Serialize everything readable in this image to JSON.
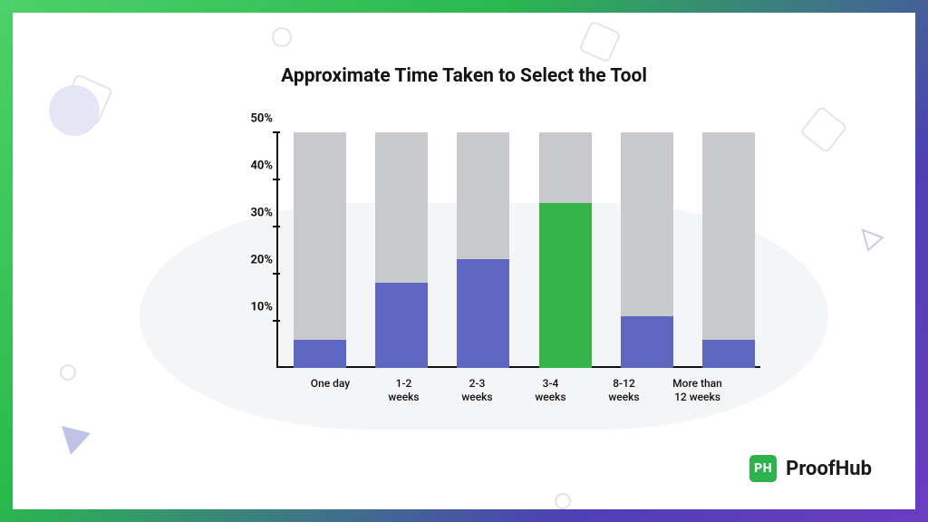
{
  "title": "Approximate Time Taken to Select the Tool",
  "chart_data": {
    "type": "bar",
    "categories": [
      "One day",
      "1-2 weeks",
      "2-3 weeks",
      "3-4 weeks",
      "8-12 weeks",
      "More than 12 weeks"
    ],
    "values": [
      6,
      18,
      23,
      35,
      11,
      6
    ],
    "highlight_index": 3,
    "ylim": [
      0,
      50
    ],
    "y_ticks": [
      10,
      20,
      30,
      40,
      50
    ],
    "y_tick_labels": [
      "10%",
      "20%",
      "30%",
      "40%",
      "50%"
    ],
    "title": "Approximate Time Taken to Select the Tool",
    "xlabel": "",
    "ylabel": ""
  },
  "xlabels_display": [
    {
      "l1": "One day",
      "l2": ""
    },
    {
      "l1": "1-2",
      "l2": "weeks"
    },
    {
      "l1": "2-3",
      "l2": "weeks"
    },
    {
      "l1": "3-4",
      "l2": "weeks"
    },
    {
      "l1": "8-12",
      "l2": "weeks"
    },
    {
      "l1": "More than",
      "l2": "12 weeks"
    }
  ],
  "brand": {
    "mark": "PH",
    "name": "ProofHub"
  }
}
